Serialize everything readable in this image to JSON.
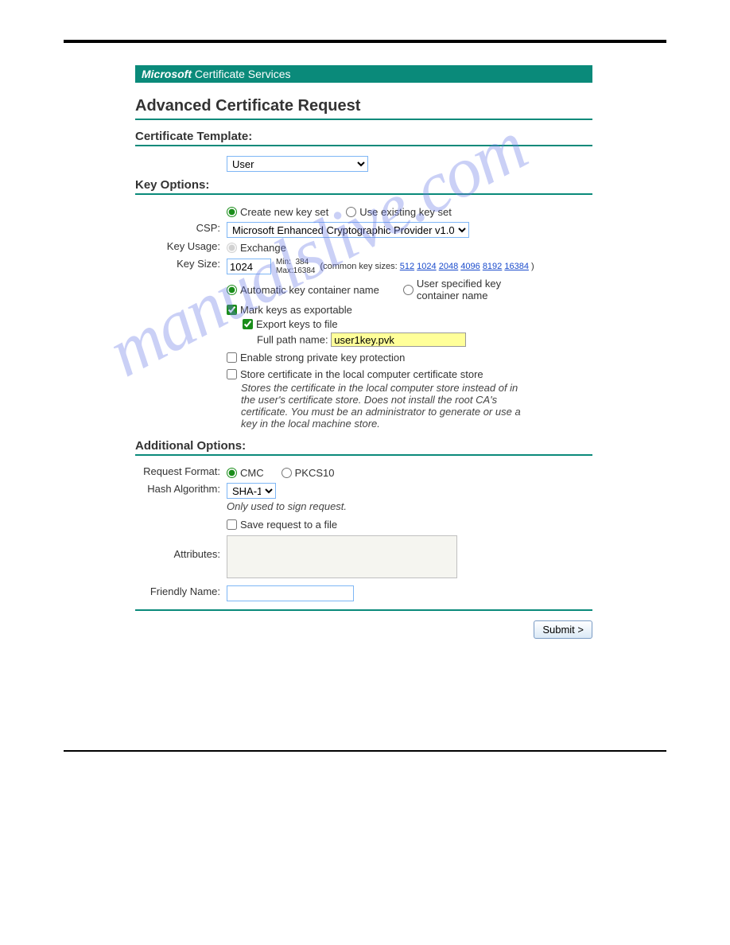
{
  "header": {
    "brand": "Microsoft",
    "suffix": " Certificate Services"
  },
  "page_title": "Advanced Certificate Request",
  "cert_template": {
    "label": "Certificate Template:",
    "value": "User"
  },
  "key_options": {
    "title": "Key Options:",
    "keyset": {
      "create_new": "Create new key set",
      "use_existing": "Use existing key set"
    },
    "csp": {
      "label": "CSP:",
      "value": "Microsoft Enhanced Cryptographic Provider v1.0"
    },
    "key_usage": {
      "label": "Key Usage:",
      "value": "Exchange"
    },
    "key_size": {
      "label": "Key Size:",
      "value": "1024",
      "min_label": "Min:",
      "min": "384",
      "max_label": "Max:",
      "max": "16384",
      "common_prefix": "(common key sizes:",
      "sizes": [
        "512",
        "1024",
        "2048",
        "4096",
        "8192",
        "16384"
      ],
      "common_suffix": ")"
    },
    "container": {
      "auto": "Automatic key container name",
      "user": "User specified key container name"
    },
    "exportable": "Mark keys as exportable",
    "export_file": "Export keys to file",
    "full_path_label": "Full path name:",
    "full_path_value": "user1key.pvk",
    "strong_protection": "Enable strong private key protection",
    "store_local": "Store certificate in the local computer certificate store",
    "store_note": "Stores the certificate in the local computer store instead of in the user's certificate store. Does not install the root CA's certificate. You must be an administrator to generate or use a key in the local machine store."
  },
  "additional": {
    "title": "Additional Options:",
    "request_format": {
      "label": "Request Format:",
      "cmc": "CMC",
      "pkcs10": "PKCS10"
    },
    "hash": {
      "label": "Hash Algorithm:",
      "value": "SHA-1",
      "note": "Only used to sign request."
    },
    "save_request": "Save request to a file",
    "attributes_label": "Attributes:",
    "friendly_label": "Friendly Name:",
    "friendly_value": ""
  },
  "submit_label": "Submit >",
  "watermark": "manualslive.com"
}
